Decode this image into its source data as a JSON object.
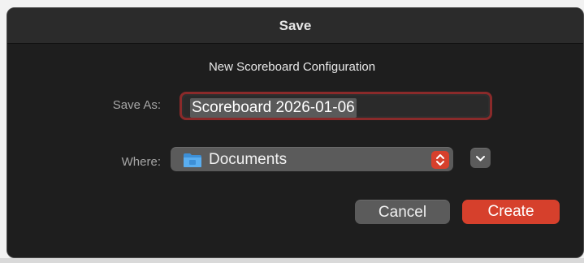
{
  "dialog": {
    "title": "Save",
    "message": "New Scoreboard Configuration"
  },
  "save_as": {
    "label": "Save As:",
    "value": "Scoreboard 2026-01-06"
  },
  "where": {
    "label": "Where:",
    "value": "Documents",
    "icon": "folder-icon"
  },
  "buttons": {
    "cancel": "Cancel",
    "create": "Create"
  },
  "colors": {
    "accent": "#d6402c",
    "focus_ring": "#8a2a2a",
    "dialog_bg": "#1f1f1f",
    "control_bg": "#5b5b5b"
  }
}
